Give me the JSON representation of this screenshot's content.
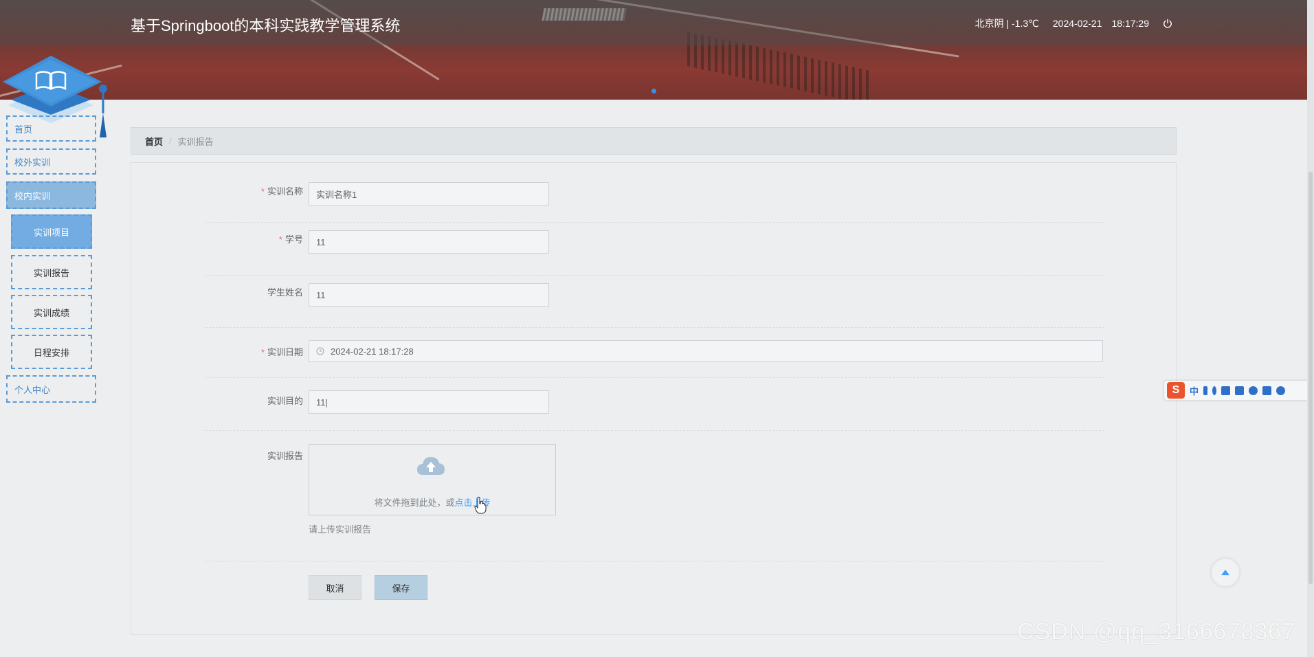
{
  "header": {
    "title": "基于Springboot的本科实践教学管理系统",
    "weather": "北京阴 | -1.3℃",
    "date": "2024-02-21",
    "time": "18:17:29"
  },
  "nav": {
    "items": [
      {
        "label": "首页"
      },
      {
        "label": "校外实训"
      },
      {
        "label": "校内实训"
      },
      {
        "label": "个人中心"
      }
    ],
    "sub_items": [
      {
        "label": "实训项目"
      },
      {
        "label": "实训报告"
      },
      {
        "label": "实训成绩"
      },
      {
        "label": "日程安排"
      }
    ]
  },
  "breadcrumb": {
    "home": "首页",
    "separator": "/",
    "current": "实训报告"
  },
  "form": {
    "project_name": {
      "label": "实训名称",
      "value": "实训名称1"
    },
    "student_no": {
      "label": "学号",
      "value": "11"
    },
    "student_name": {
      "label": "学生姓名",
      "value": "11"
    },
    "date": {
      "label": "实训日期",
      "value": "2024-02-21 18:17:28"
    },
    "purpose": {
      "label": "实训目的",
      "value": "11|"
    },
    "report": {
      "label": "实训报告",
      "drop_text": "将文件拖到此处，或",
      "link_text": "点击上传",
      "tip": "请上传实训报告"
    },
    "cancel_label": "取消",
    "save_label": "保存"
  },
  "ime": {
    "lang": "中"
  },
  "watermark": "CSDN @qq_3166678367",
  "colors": {
    "accent": "#409eff",
    "nav_border": "#5b9bd5",
    "nav_active": "#8cb8e0",
    "sub_active": "#73ace2",
    "required": "#f56c6c",
    "ime_logo": "#e9542f"
  }
}
